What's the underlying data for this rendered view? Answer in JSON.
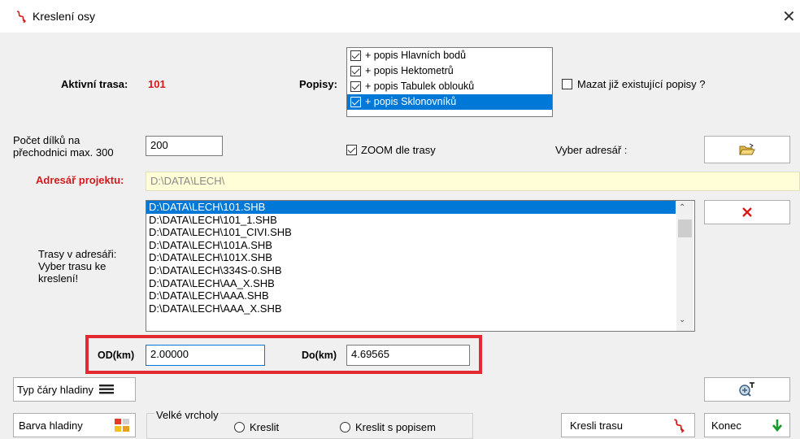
{
  "window": {
    "title": "Kreslení osy",
    "close": "✕"
  },
  "active": {
    "label": "Aktivní trasa:",
    "value": "101"
  },
  "popisy": {
    "label": "Popisy:",
    "items": [
      {
        "label": "+ popis Hlavních bodů",
        "checked": true
      },
      {
        "label": "+ popis Hektometrů",
        "checked": true
      },
      {
        "label": "+ popis Tabulek oblouků",
        "checked": true
      },
      {
        "label": "+ popis Sklonovníků",
        "checked": true,
        "selected": true
      }
    ]
  },
  "mazat": {
    "label": "Mazat již existující  popisy ?",
    "checked": false
  },
  "pocet": {
    "label_line1": "Počet dílků na",
    "label_line2": "přechodnici max. 300",
    "value": "200"
  },
  "zoom": {
    "label": "ZOOM dle trasy",
    "checked": true
  },
  "vyber": {
    "label": "Vyber adresář :"
  },
  "adresar": {
    "label": "Adresář projektu:",
    "value": "D:\\DATA\\LECH\\"
  },
  "trasy": {
    "label_line1": "Trasy v adresáři:",
    "label_line2": "Vyber trasu ke",
    "label_line3": "kreslení!",
    "files": [
      "D:\\DATA\\LECH\\101.SHB",
      "D:\\DATA\\LECH\\101_1.SHB",
      "D:\\DATA\\LECH\\101_CIVI.SHB",
      "D:\\DATA\\LECH\\101A.SHB",
      "D:\\DATA\\LECH\\101X.SHB",
      "D:\\DATA\\LECH\\334S-0.SHB",
      "D:\\DATA\\LECH\\AA_X.SHB",
      "D:\\DATA\\LECH\\AAA.SHB",
      "D:\\DATA\\LECH\\AAA_X.SHB"
    ]
  },
  "range": {
    "od_label": "OD(km)",
    "od_value": "2.00000",
    "do_label": "Do(km)",
    "do_value": "4.69565"
  },
  "buttons": {
    "typ": "Typ čáry hladiny",
    "barva": "Barva hladiny",
    "kresli": "Kresli trasu",
    "konec": "Konec"
  },
  "vrcholy": {
    "label": "Velké vrcholy",
    "opt1": "Kreslit",
    "opt2": "Kreslit s popisem"
  },
  "colors": {
    "accent": "#0078d7",
    "red": "#d61a1a",
    "highlight_box": "#e32a32",
    "readonly_bg": "#fffed7"
  }
}
